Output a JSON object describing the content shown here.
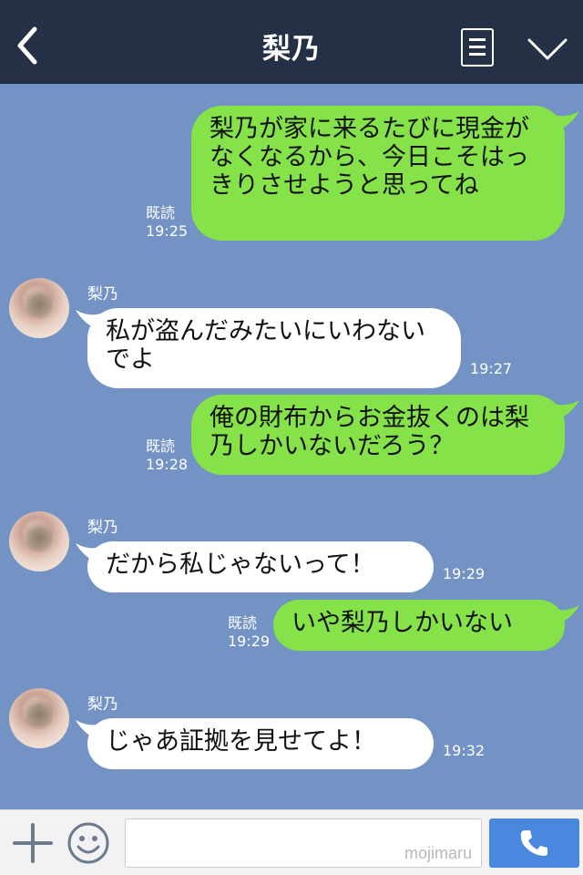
{
  "header": {
    "title": "梨乃"
  },
  "messages": [
    {
      "side": "me",
      "text": "梨乃が家に来るたびに現金がなくなるから、今日こそはっきりさせようと思ってね",
      "read": "既読",
      "time": "19:25"
    },
    {
      "side": "them",
      "sender": "梨乃",
      "text": "私が盗んだみたいにいわないでよ",
      "time": "19:27"
    },
    {
      "side": "me",
      "text": "俺の財布からお金抜くのは梨乃しかいないだろう？",
      "read": "既読",
      "time": "19:28"
    },
    {
      "side": "them",
      "sender": "梨乃",
      "text": "だから私じゃないって！",
      "time": "19:29"
    },
    {
      "side": "me",
      "text": "いや梨乃しかいない",
      "read": "既読",
      "time": "19:29"
    },
    {
      "side": "them",
      "sender": "梨乃",
      "text": "じゃあ証拠を見せてよ！",
      "time": "19:32"
    }
  ],
  "footer": {
    "input_value": "",
    "watermark": "mojimaru"
  },
  "colors": {
    "header": "#243046",
    "background": "#7293c3",
    "my_bubble": "#85e249",
    "their_bubble": "#ffffff",
    "call_button": "#4a88e0"
  },
  "icons": [
    "back-arrow-icon",
    "menu-icon",
    "chevron-down-icon",
    "plus-icon",
    "smiley-icon",
    "phone-icon"
  ]
}
